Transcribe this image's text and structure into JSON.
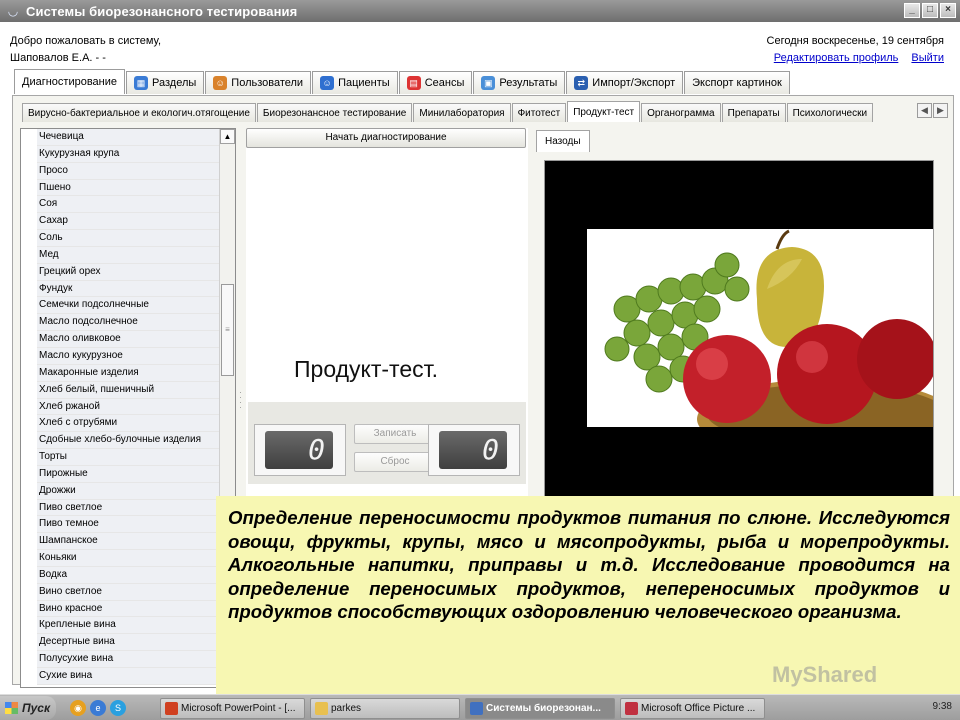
{
  "window": {
    "title": "Системы биорезонансного тестирования"
  },
  "header": {
    "welcome_line1": "Добро пожаловать в систему,",
    "welcome_line2": "Шаповалов Е.А. - -",
    "date_text": "Сегодня воскресенье, 19 сентября",
    "edit_profile": "Редактировать профиль",
    "logout": "Выйти"
  },
  "main_tabs": [
    {
      "label": "Диагностирование",
      "icon": "none"
    },
    {
      "label": "Разделы",
      "icon": "sections-icon"
    },
    {
      "label": "Пользователи",
      "icon": "users-icon"
    },
    {
      "label": "Пациенты",
      "icon": "patients-icon"
    },
    {
      "label": "Сеансы",
      "icon": "calendar-icon"
    },
    {
      "label": "Результаты",
      "icon": "results-icon"
    },
    {
      "label": "Импорт/Экспорт",
      "icon": "import-export-icon"
    },
    {
      "label": "Экспорт картинок",
      "icon": "none"
    }
  ],
  "sub_tabs": [
    "Вирусно-бактериальное и екологич.отягощение",
    "Биорезонансное тестирование",
    "Минилаборатория",
    "Фитотест",
    "Продукт-тест",
    "Органограмма",
    "Препараты",
    "Психологически"
  ],
  "products": [
    "Чечевица",
    "Кукурузная крупа",
    "Просо",
    "Пшено",
    "Соя",
    "Сахар",
    "Соль",
    "Мед",
    "Грецкий орех",
    "Фундук",
    "Семечки подсолнечные",
    "Масло подсолнечное",
    "Масло оливковое",
    "Масло кукурузное",
    "Макаронные изделия",
    "Хлеб белый, пшеничный",
    "Хлеб ржаной",
    "Хлеб с отрубями",
    "Сдобные хлебо-булочные изделия",
    "Торты",
    "Пирожные",
    "Дрожжи",
    "Пиво светлое",
    "Пиво темное",
    "Шампанское",
    "Коньяки",
    "Водка",
    "Вино светлое",
    "Вино красное",
    "Крепленые вина",
    "Десертные вина",
    "Полусухие вина",
    "Сухие вина"
  ],
  "center": {
    "start_button": "Начать диагностирование",
    "big_label": "Продукт-тест.",
    "counter_left": "0",
    "counter_right": "0",
    "save_button": "Записать",
    "reset_button": "Сброс"
  },
  "right": {
    "tab_label": "Назоды"
  },
  "overlay": {
    "text": "Определение переносимости продуктов питания по слюне. Исследуются овощи, фрукты, крупы, мясо и мясопродукты, рыба и морепродукты. Алкогольные напитки, приправы и т.д. Исследование проводится на определение переносимых продуктов, непереносимых продуктов и продуктов способствующих оздоровлению человеческого организма."
  },
  "watermark": "MyShared",
  "taskbar": {
    "start": "Пуск",
    "items": [
      "Microsoft PowerPoint - [...",
      "parkes",
      "Системы биорезонан...",
      "Microsoft Office Picture ..."
    ],
    "clock": "9:38"
  }
}
